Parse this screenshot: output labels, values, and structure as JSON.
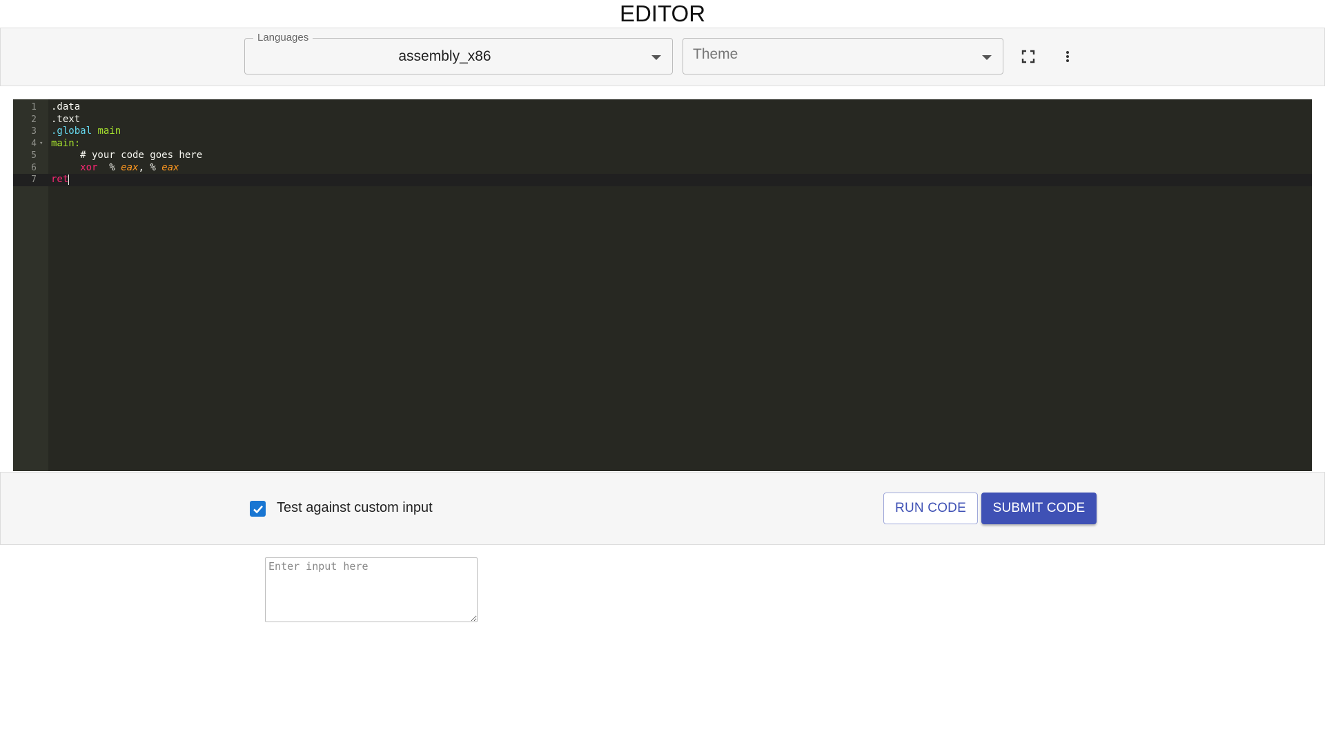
{
  "page": {
    "title": "EDITOR"
  },
  "toolbar": {
    "languages_label": "Languages",
    "languages_value": "assembly_x86",
    "theme_placeholder": "Theme",
    "fullscreen_icon": "fullscreen-icon",
    "more_icon": "more-vert-icon"
  },
  "editor": {
    "line_numbers": [
      "1",
      "2",
      "3",
      "4",
      "5",
      "6",
      "7"
    ],
    "lines": [
      {
        "parts": [
          {
            "text": ".data",
            "kind": "white"
          }
        ]
      },
      {
        "parts": [
          {
            "text": ".text",
            "kind": "white"
          }
        ]
      },
      {
        "parts": [
          {
            "text": ".global",
            "kind": "cyan"
          },
          {
            "text": " main",
            "kind": "green"
          }
        ]
      },
      {
        "parts": [
          {
            "text": "main:",
            "kind": "green"
          }
        ]
      },
      {
        "parts": [
          {
            "text": "     # your code goes here",
            "kind": "white"
          }
        ]
      },
      {
        "parts": [
          {
            "text": "     ",
            "kind": "white"
          },
          {
            "text": "xor",
            "kind": "red"
          },
          {
            "text": "  % ",
            "kind": "white"
          },
          {
            "text": "eax",
            "kind": "orange"
          },
          {
            "text": ", % ",
            "kind": "white"
          },
          {
            "text": "eax",
            "kind": "orange"
          }
        ]
      },
      {
        "parts": [
          {
            "text": "ret",
            "kind": "red"
          }
        ]
      }
    ],
    "colors": {
      "background": "#272822",
      "white": "#f8f8f2",
      "cyan": "#66d9ef",
      "green": "#a6e22e",
      "red": "#f92672",
      "orange": "#fd971f"
    }
  },
  "run": {
    "custom_input_label": "Test against custom input",
    "custom_input_checked": true,
    "run_label": "RUN CODE",
    "submit_label": "SUBMIT CODE",
    "input_placeholder": "Enter input here",
    "accent": "#3f51b5"
  }
}
